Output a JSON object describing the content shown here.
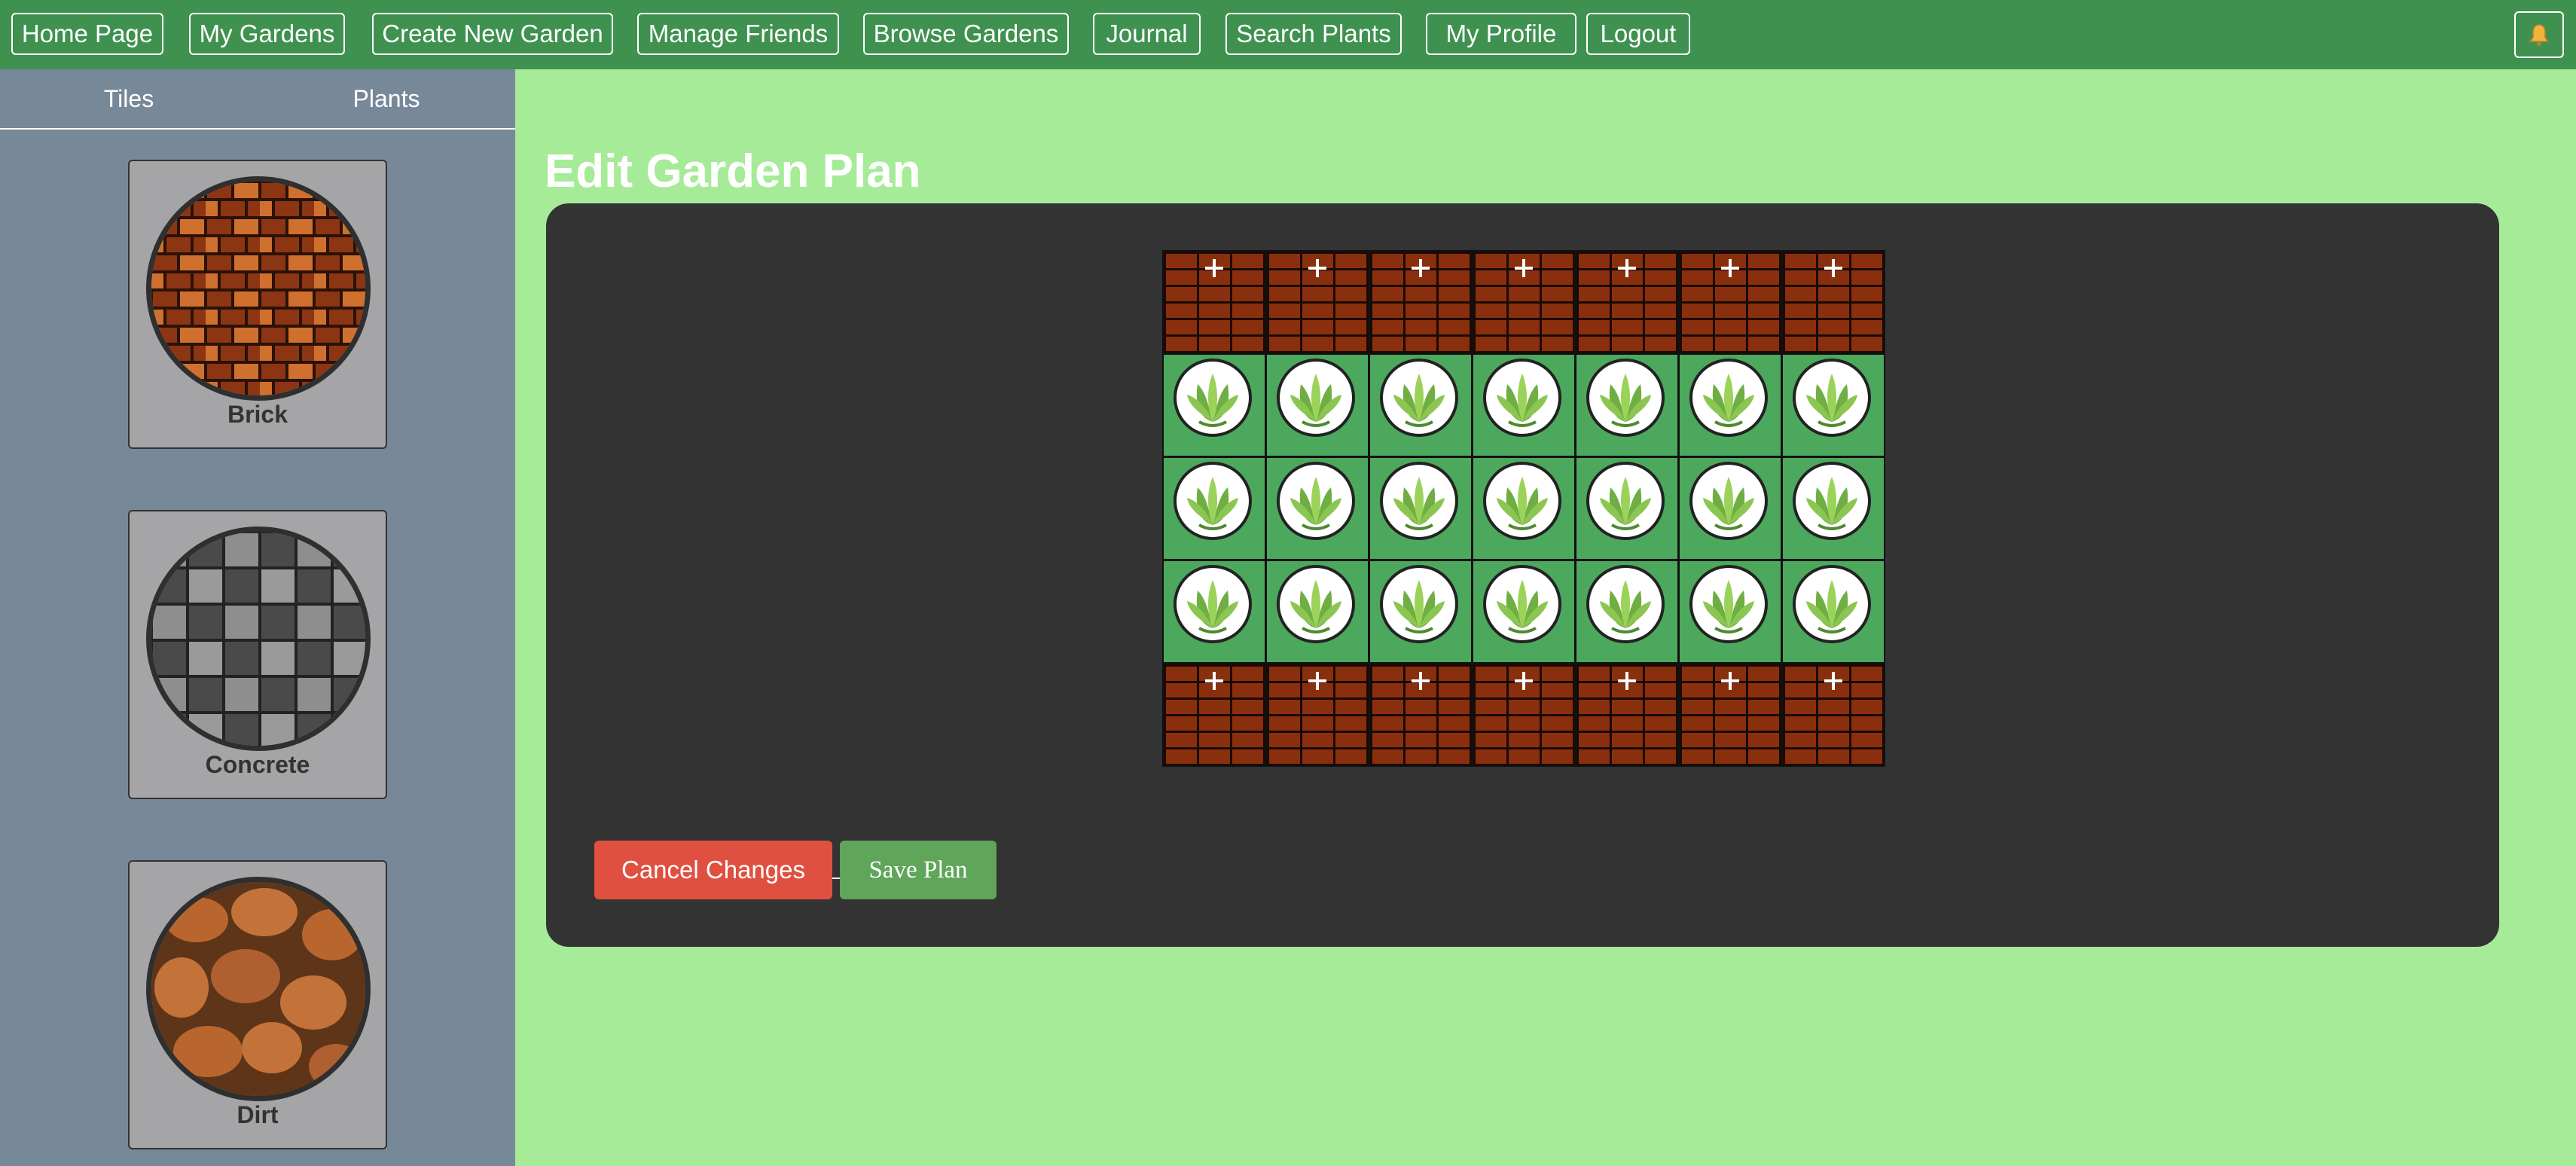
{
  "nav": {
    "items": [
      {
        "label": "Home Page"
      },
      {
        "label": "My Gardens"
      },
      {
        "label": "Create New Garden"
      },
      {
        "label": "Manage Friends"
      },
      {
        "label": "Browse Gardens"
      },
      {
        "label": "Journal"
      },
      {
        "label": "Search Plants"
      },
      {
        "label": "My Profile"
      },
      {
        "label": "Logout"
      }
    ],
    "bell_icon": "bell-icon"
  },
  "sidebar": {
    "tabs": [
      {
        "label": "Tiles"
      },
      {
        "label": "Plants"
      }
    ],
    "tiles": [
      {
        "label": "Brick",
        "icon": "brick-tile"
      },
      {
        "label": "Concrete",
        "icon": "concrete-tile"
      },
      {
        "label": "Dirt",
        "icon": "dirt-tile"
      }
    ]
  },
  "main": {
    "title": "Edit Garden Plan",
    "grid": {
      "rows": [
        [
          "brick",
          "brick",
          "brick",
          "brick",
          "brick",
          "brick",
          "brick"
        ],
        [
          "grass-plant",
          "grass-plant",
          "grass-plant",
          "grass-plant",
          "grass-plant",
          "grass-plant",
          "grass-plant"
        ],
        [
          "grass-plant",
          "grass-plant",
          "grass-plant",
          "grass-plant",
          "grass-plant",
          "grass-plant",
          "grass-plant"
        ],
        [
          "grass-plant",
          "grass-plant",
          "grass-plant",
          "grass-plant",
          "grass-plant",
          "grass-plant",
          "grass-plant"
        ],
        [
          "brick",
          "brick",
          "brick",
          "brick",
          "brick",
          "brick",
          "brick"
        ]
      ]
    },
    "cancel_label": "Cancel Changes",
    "save_label": "Save Plan"
  },
  "colors": {
    "nav_bg": "#3f9150",
    "page_bg": "#a6eb98",
    "sidebar_bg": "#778899",
    "panel_bg": "#333333",
    "cancel": "#e05040",
    "save": "#5fa55a",
    "brick": "#8a2f0d",
    "grass": "#4ca85c"
  }
}
